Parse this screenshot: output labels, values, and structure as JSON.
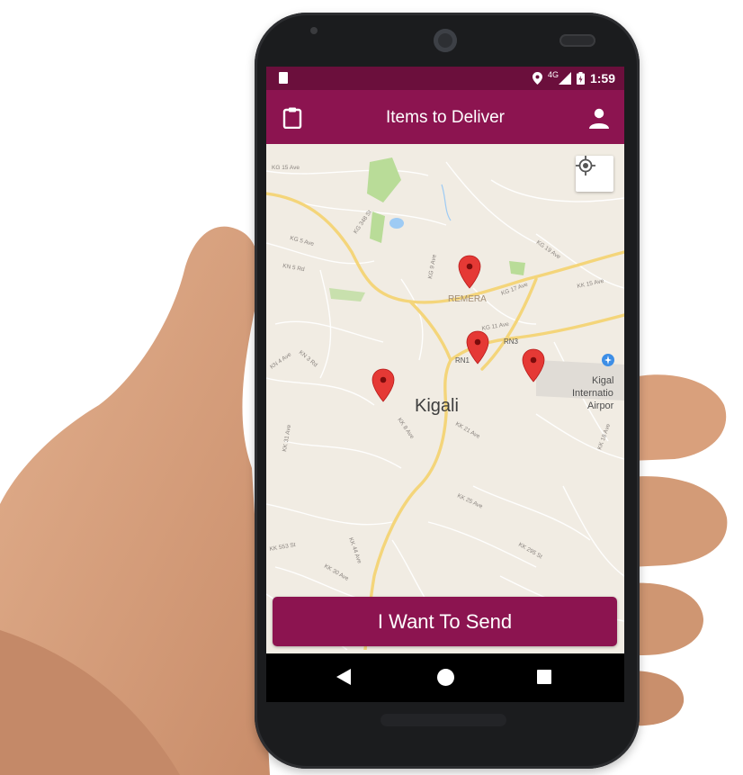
{
  "statusbar": {
    "network": "4G",
    "time": "1:59"
  },
  "appbar": {
    "title": "Items to Deliver",
    "left_icon": "clipboard-icon",
    "right_icon": "person-icon"
  },
  "map": {
    "city_label": "Kigali",
    "district_label": "REMERA",
    "airport_label_line1": "Kigal",
    "airport_label_line2": "Internatio",
    "airport_label_line3": "Airpor",
    "road_labels": [
      "KG 15 Ave",
      "KG 5 Ave",
      "KN 5 Rd",
      "KG 348 St",
      "KG 9 Ave",
      "KG 19 Ave",
      "KG 17 Ave",
      "KK 15 Ave",
      "KG 11 Ave",
      "RN3",
      "RN1",
      "KN 4 Ave",
      "KN 3 Rd",
      "KK 8 Ave",
      "KK 21 Ave",
      "KK 31 Ave",
      "KK 25 Ave",
      "KK 18 Ave",
      "KK 553 St",
      "KK 44 Ave",
      "KK 30 Ave",
      "KK 295 St"
    ],
    "marker_count": 4,
    "colors": {
      "marker": "#e53935",
      "road_major": "#f7dc8a",
      "park": "#b9dc98",
      "water": "#9ecbf4"
    }
  },
  "locate_button": {
    "icon": "my-location-icon"
  },
  "send_button": {
    "label": "I Want To Send"
  },
  "navbar": {
    "back_icon": "back-triangle-icon",
    "home_icon": "home-circle-icon",
    "recent_icon": "recent-square-icon"
  },
  "colors": {
    "primary": "#8c1450",
    "primary_dark": "#6b0f3c"
  }
}
